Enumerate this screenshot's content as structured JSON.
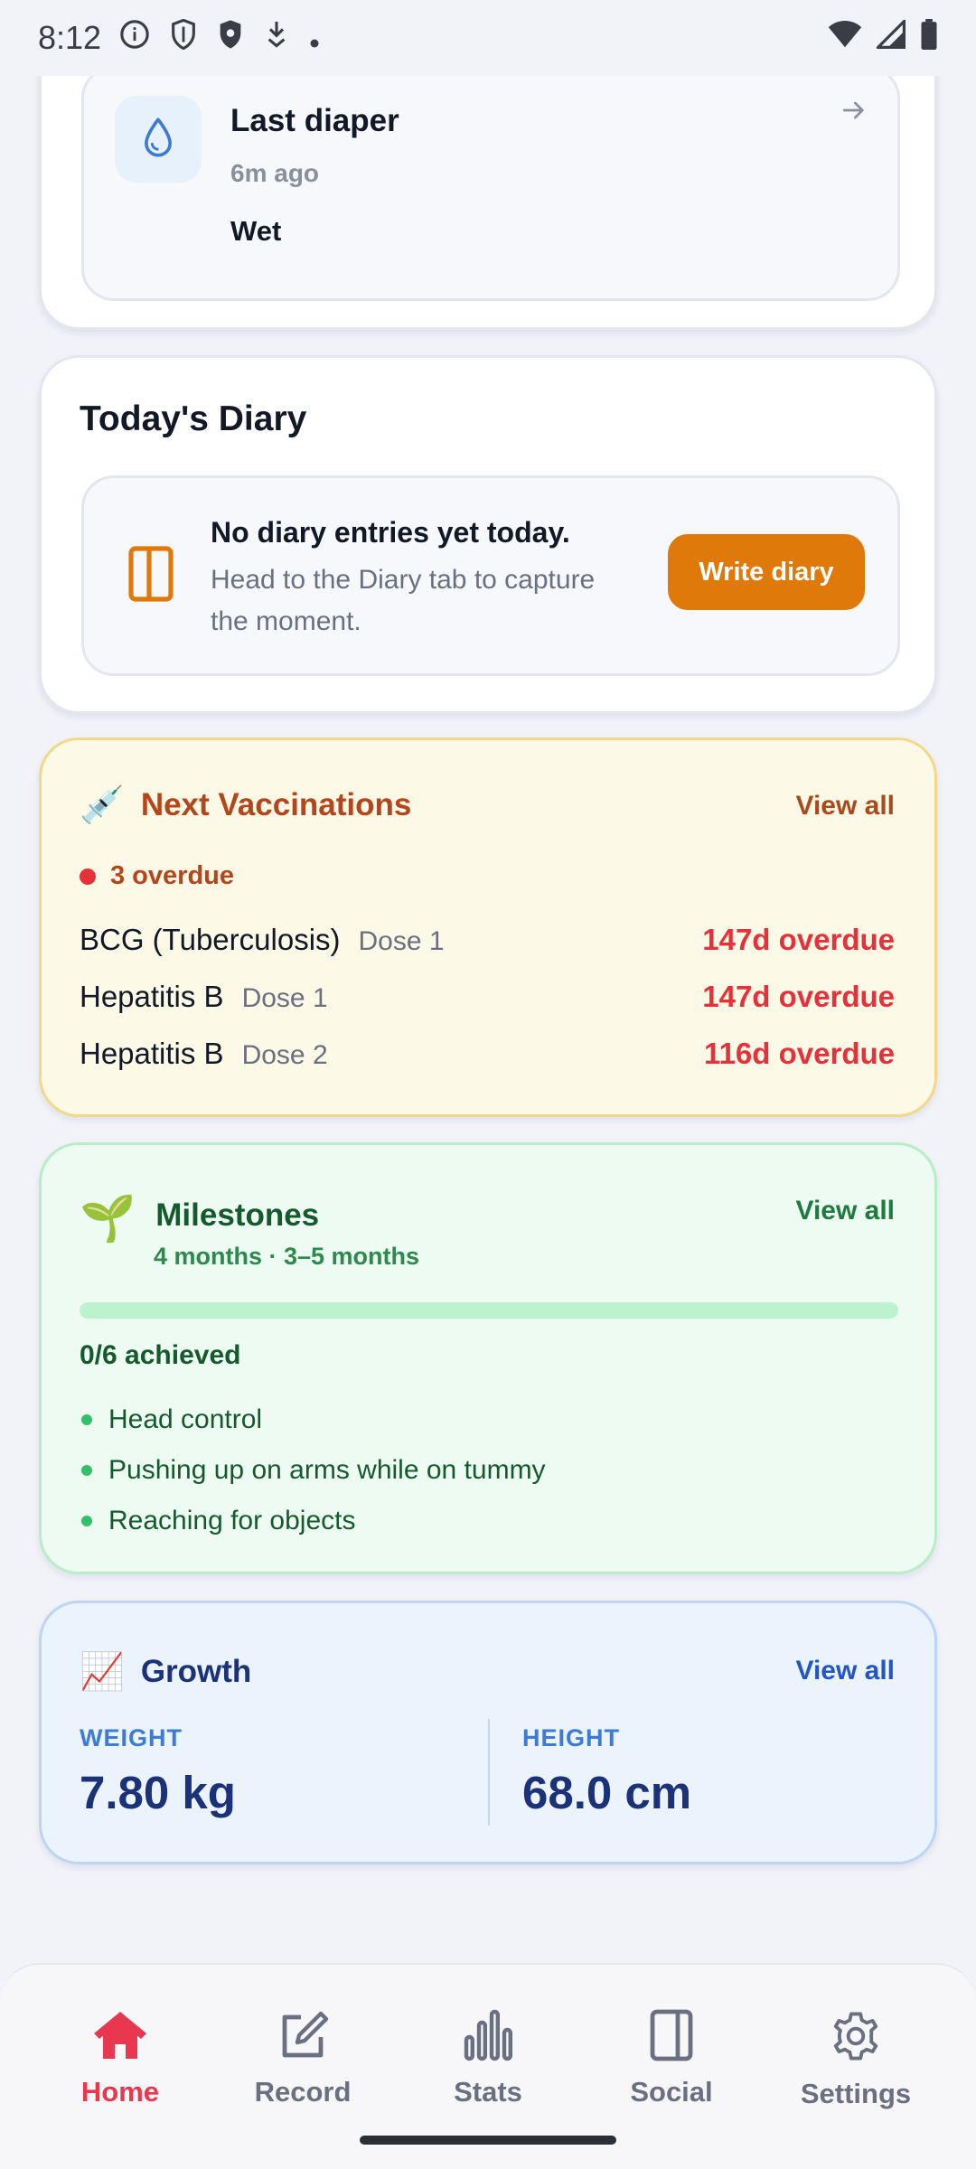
{
  "status_bar": {
    "time": "8:12"
  },
  "last_diaper": {
    "title": "Last diaper",
    "time_ago": "6m ago",
    "type": "Wet"
  },
  "diary": {
    "title": "Today's Diary",
    "empty_title": "No diary entries yet today.",
    "empty_subtitle": "Head to the Diary tab to capture the moment.",
    "write_button": "Write diary"
  },
  "vaccinations": {
    "icon": "💉",
    "title": "Next Vaccinations",
    "view_all": "View all",
    "overdue_summary": "3 overdue",
    "items": [
      {
        "name": "BCG (Tuberculosis)",
        "dose": "Dose 1",
        "status": "147d overdue"
      },
      {
        "name": "Hepatitis B",
        "dose": "Dose 1",
        "status": "147d overdue"
      },
      {
        "name": "Hepatitis B",
        "dose": "Dose 2",
        "status": "116d overdue"
      }
    ],
    "status_color": "#e5323a"
  },
  "milestones": {
    "icon": "🌱",
    "title": "Milestones",
    "subtitle": "4 months · 3–5 months",
    "view_all": "View all",
    "achieved": "0/6 achieved",
    "progress_fraction": 0,
    "items": [
      "Head control",
      "Pushing up on arms while on tummy",
      "Reaching for objects"
    ]
  },
  "growth": {
    "icon": "📈",
    "title": "Growth",
    "view_all": "View all",
    "weight_label": "WEIGHT",
    "weight_value": "7.80 kg",
    "height_label": "HEIGHT",
    "height_value": "68.0 cm"
  },
  "nav": {
    "active": "home",
    "items": [
      {
        "id": "home",
        "label": "Home",
        "icon": "home-icon"
      },
      {
        "id": "record",
        "label": "Record",
        "icon": "edit-icon"
      },
      {
        "id": "stats",
        "label": "Stats",
        "icon": "bar-chart-icon"
      },
      {
        "id": "social",
        "label": "Social",
        "icon": "book-icon"
      },
      {
        "id": "settings",
        "label": "Settings",
        "icon": "gear-icon"
      }
    ]
  },
  "colors": {
    "accent_active": "#e8384f",
    "diary_button": "#df7a0a",
    "vaccination_title": "#b3461c",
    "milestone_title": "#17592f",
    "growth_title": "#1b3278"
  }
}
